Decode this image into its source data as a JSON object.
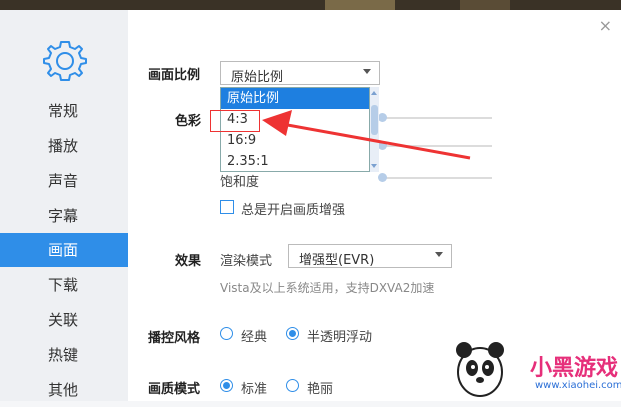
{
  "window": {
    "close_glyph": "×"
  },
  "sidebar": {
    "items": [
      {
        "label": "常规"
      },
      {
        "label": "播放"
      },
      {
        "label": "声音"
      },
      {
        "label": "字幕"
      },
      {
        "label": "画面",
        "active": true
      },
      {
        "label": "下载"
      },
      {
        "label": "关联"
      },
      {
        "label": "热键"
      },
      {
        "label": "其他"
      }
    ]
  },
  "main": {
    "aspect": {
      "label": "画面比例",
      "value": "原始比例",
      "options": [
        "原始比例",
        "4:3",
        "16:9",
        "2.35:1"
      ]
    },
    "color": {
      "label": "色彩",
      "saturation_label": "饱和度"
    },
    "enhance_checkbox": {
      "label": "总是开启画质增强",
      "checked": false
    },
    "effect": {
      "label": "效果",
      "render_label": "渲染模式",
      "render_value": "增强型(EVR)",
      "hint": "Vista及以上系统适用，支持DXVA2加速"
    },
    "control_style": {
      "label": "播控风格",
      "options": [
        {
          "label": "经典",
          "selected": false
        },
        {
          "label": "半透明浮动",
          "selected": true
        }
      ]
    },
    "quality_mode": {
      "label": "画质模式",
      "options": [
        {
          "label": "标准",
          "selected": true
        },
        {
          "label": "艳丽",
          "selected": false
        }
      ]
    }
  },
  "watermark": {
    "brand": "小黑游戏",
    "url": "www.xiaohei.com"
  },
  "colors": {
    "accent": "#2f8ee8",
    "annotation": "#e33333"
  }
}
